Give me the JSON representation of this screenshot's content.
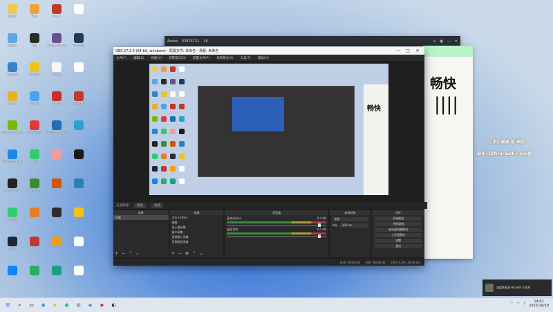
{
  "desktop": {
    "icons": [
      {
        "label": "此电脑",
        "color": "#f2c94c"
      },
      {
        "label": "Ekko",
        "color": "#f2a13a"
      },
      {
        "label": "Dota 2",
        "color": "#c0392b"
      },
      {
        "label": "",
        "color": "#ffffff"
      },
      {
        "label": "回收站",
        "color": "#5aa9e6"
      },
      {
        "label": "QQ",
        "color": "#2a2a2a"
      },
      {
        "label": "Project Winter",
        "color": "#6b4f8a"
      },
      {
        "label": "英雄联盟",
        "color": "#1f3b5c"
      },
      {
        "label": "控制面板",
        "color": "#3a83c8"
      },
      {
        "label": "QQ音乐",
        "color": "#f1c40f"
      },
      {
        "label": "Steam",
        "color": "#f7f7f7"
      },
      {
        "label": "",
        "color": "#ffffff"
      },
      {
        "label": "文件夹",
        "color": "#e6b422"
      },
      {
        "label": "网易云",
        "color": "#49a3f2"
      },
      {
        "label": "Steam",
        "color": "#c9302c"
      },
      {
        "label": "Among Us",
        "color": "#c0392b"
      },
      {
        "label": "GeForce Experience",
        "color": "#76b900"
      },
      {
        "label": "网易云音乐",
        "color": "#e4393c"
      },
      {
        "label": "Wallpaper Engine",
        "color": "#1e6fb5"
      },
      {
        "label": "",
        "color": "#2aa3d4"
      },
      {
        "label": "Microsoft Edge",
        "color": "#1e88e5"
      },
      {
        "label": "微信",
        "color": "#2ecc71"
      },
      {
        "label": "",
        "color": "#f39c9c"
      },
      {
        "label": "",
        "color": "#1a1a1a"
      },
      {
        "label": "OBS Studio",
        "color": "#222222"
      },
      {
        "label": "Minecraft",
        "color": "#3c8d2f"
      },
      {
        "label": "",
        "color": "#d35400"
      },
      {
        "label": "",
        "color": "#2980b9"
      },
      {
        "label": "QQ游戏",
        "color": "#2ecc71"
      },
      {
        "label": "",
        "color": "#e67e22"
      },
      {
        "label": "",
        "color": "#2c2c2c"
      },
      {
        "label": "",
        "color": "#f1c40f"
      },
      {
        "label": "Steam",
        "color": "#1b2838"
      },
      {
        "label": "",
        "color": "#c0392b"
      },
      {
        "label": "",
        "color": "#f39c12"
      },
      {
        "label": "",
        "color": "#ffffff"
      },
      {
        "label": "",
        "color": "#0a84ff"
      },
      {
        "label": "",
        "color": "#27ae60"
      },
      {
        "label": "",
        "color": "#16a085"
      },
      {
        "label": "",
        "color": "#ffffff"
      }
    ]
  },
  "back_window": {
    "title": "Aiolos",
    "id": "32976721",
    "count": "26"
  },
  "chat_window": {
    "big_text": "畅快",
    "glyph": "||||"
  },
  "promo": {
    "line1": "丨丨说小猫猫 饭 珐韵",
    "line2": "联系<珐韵Hiraeth>加vx群"
  },
  "obs": {
    "title": "OBS 27.2.4 (64-bit, windows) - 配置文件: 未命名 - 场景: 未命名",
    "menu": [
      "文件(F)",
      "编辑(E)",
      "视图(V)",
      "停靠窗口(D)",
      "配置文件(P)",
      "场景集合(S)",
      "工具(T)",
      "帮助(H)"
    ],
    "scene_bar": {
      "left": "未选择源",
      "tab1": "属性",
      "tab2": "滤镜"
    },
    "docks": {
      "scenes": {
        "header": "场景",
        "items": [
          "场景"
        ]
      },
      "sources": {
        "header": "来源",
        "items": [
          "文本 (GDI+)",
          "图像",
          "显示器采集",
          "窗口采集",
          "音频输入采集",
          "音频输出采集"
        ]
      },
      "mixer": {
        "header": "混音器",
        "tracks": [
          {
            "name": "麦克风/Aux",
            "db": "0.0 dB"
          },
          {
            "name": "桌面音频",
            "db": "0.0 dB"
          }
        ]
      },
      "transitions": {
        "header": "转场特效",
        "type": "渐变",
        "duration_label": "时长",
        "duration": "300 ms"
      },
      "controls": {
        "header": "控件",
        "buttons": [
          "开始推流",
          "开始录制",
          "启动虚拟摄像机",
          "工作室模式",
          "设置",
          "退出"
        ]
      }
    },
    "status": {
      "live": "LIVE: 00:00:00",
      "rec": "REC: 00:00:00",
      "cpu": "CPU: 0.6%, 30.00 fps"
    }
  },
  "notification": {
    "text": "流媒体推流 Hiraeth 已发布"
  },
  "taskbar": {
    "clock_time": "14:01",
    "clock_date": "2022/10/19"
  }
}
